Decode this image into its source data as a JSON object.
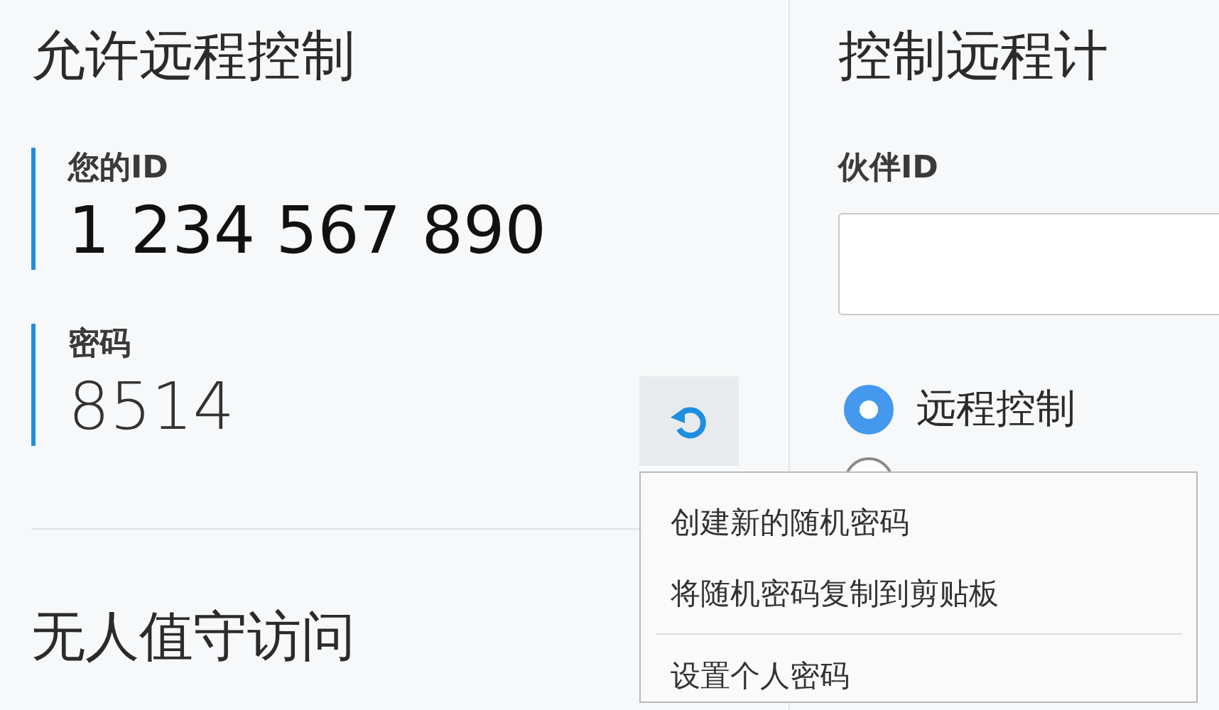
{
  "allow_remote": {
    "title": "允许远程控制",
    "your_id": {
      "label": "您的ID",
      "value": "1 234 567 890"
    },
    "password": {
      "label": "密码",
      "value": "8514"
    }
  },
  "unattended": {
    "title": "无人值守访问"
  },
  "control_remote": {
    "title": "控制远程计",
    "partner_id": {
      "label": "伙伴ID"
    },
    "modes": [
      {
        "label": "远程控制",
        "selected": true
      },
      {
        "selected": false
      }
    ]
  },
  "password_menu": {
    "items": [
      {
        "label": "创建新的随机密码",
        "kind": "item"
      },
      {
        "label": "将随机密码复制到剪贴板",
        "kind": "item"
      },
      {
        "kind": "separator"
      },
      {
        "label": "设置个人密码",
        "kind": "item"
      }
    ]
  }
}
